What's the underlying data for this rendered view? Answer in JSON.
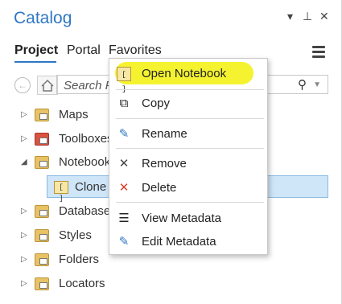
{
  "pane": {
    "title": "Catalog",
    "controls": {
      "menu": "▾",
      "pin": "⊥",
      "close": "✕"
    }
  },
  "tabs": [
    {
      "label": "Project",
      "active": true
    },
    {
      "label": "Portal",
      "active": false
    },
    {
      "label": "Favorites",
      "active": false
    }
  ],
  "search": {
    "placeholder": "Search Project"
  },
  "tree": [
    {
      "label": "Maps",
      "icon": "maps-folder-icon"
    },
    {
      "label": "Toolboxes",
      "icon": "toolbox-folder-icon"
    },
    {
      "label": "Notebooks",
      "icon": "notebooks-folder-icon",
      "expanded": true
    },
    {
      "label": "Clone",
      "icon": "notebook-icon",
      "selected": true
    },
    {
      "label": "Databases",
      "icon": "database-folder-icon"
    },
    {
      "label": "Styles",
      "icon": "styles-folder-icon"
    },
    {
      "label": "Folders",
      "icon": "folders-folder-icon"
    },
    {
      "label": "Locators",
      "icon": "locators-folder-icon"
    }
  ],
  "context_menu": {
    "items": [
      {
        "label": "Open Notebook",
        "icon": "open-notebook-icon",
        "highlighted": true
      },
      {
        "label": "Copy",
        "icon": "copy-icon"
      },
      {
        "label": "Rename",
        "icon": "rename-icon"
      },
      {
        "label": "Remove",
        "icon": "remove-icon"
      },
      {
        "label": "Delete",
        "icon": "delete-icon"
      },
      {
        "label": "View Metadata",
        "icon": "view-metadata-icon"
      },
      {
        "label": "Edit Metadata",
        "icon": "edit-metadata-icon"
      }
    ]
  },
  "colors": {
    "accent": "#2f77c4",
    "selection": "#cfe5f8",
    "highlighter": "#f4f21a",
    "delete_red": "#d9402b"
  }
}
